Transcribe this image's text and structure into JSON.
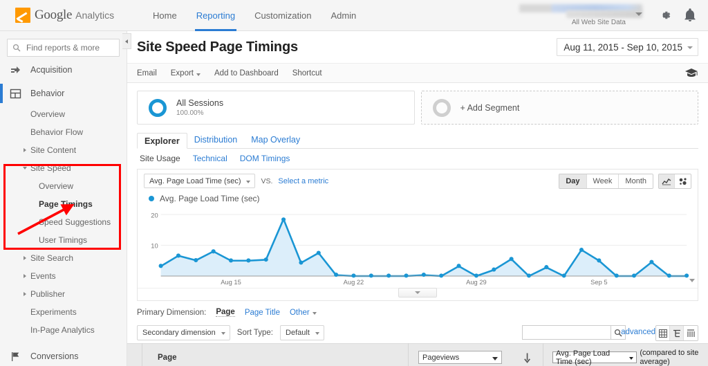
{
  "topbar": {
    "logo_text_1": "Google",
    "logo_text_2": "Analytics",
    "nav": [
      {
        "label": "Home",
        "active": false
      },
      {
        "label": "Reporting",
        "active": true
      },
      {
        "label": "Customization",
        "active": false
      },
      {
        "label": "Admin",
        "active": false
      }
    ],
    "account_view": "All Web Site Data",
    "gear_icon": "gear-icon",
    "bell_icon": "bell-icon"
  },
  "sidebar": {
    "search_placeholder": "Find reports & more",
    "search_value": "",
    "groups": [
      {
        "label": "Acquisition",
        "icon": "acquisition-icon"
      },
      {
        "label": "Behavior",
        "icon": "behavior-icon"
      },
      {
        "label": "Conversions",
        "icon": "conversions-flag-icon"
      }
    ],
    "behavior_items": [
      {
        "label": "Overview",
        "type": "leaf"
      },
      {
        "label": "Behavior Flow",
        "type": "leaf"
      },
      {
        "label": "Site Content",
        "type": "expandable"
      },
      {
        "label": "Site Speed",
        "type": "expanded"
      },
      {
        "label": "Overview",
        "type": "sub"
      },
      {
        "label": "Page Timings",
        "type": "sub-active"
      },
      {
        "label": "Speed Suggestions",
        "type": "sub"
      },
      {
        "label": "User Timings",
        "type": "sub"
      },
      {
        "label": "Site Search",
        "type": "expandable"
      },
      {
        "label": "Events",
        "type": "expandable"
      },
      {
        "label": "Publisher",
        "type": "expandable"
      },
      {
        "label": "Experiments",
        "type": "leaf"
      },
      {
        "label": "In-Page Analytics",
        "type": "leaf"
      }
    ],
    "annotation_color": "#ff0000"
  },
  "main": {
    "page_title": "Site Speed Page Timings",
    "date_range": "Aug 11, 2015 - Sep 10, 2015",
    "actions": [
      {
        "label": "Email",
        "caret": false
      },
      {
        "label": "Export",
        "caret": true
      },
      {
        "label": "Add to Dashboard",
        "caret": false
      },
      {
        "label": "Shortcut",
        "caret": false
      }
    ],
    "help_icon": "graduation-cap-icon",
    "segments": [
      {
        "name": "All Sessions",
        "percent": "100.00%"
      },
      {
        "name": "+ Add Segment"
      }
    ],
    "tabs": [
      {
        "label": "Explorer",
        "active": true
      },
      {
        "label": "Distribution",
        "active": false
      },
      {
        "label": "Map Overlay",
        "active": false
      }
    ],
    "subtabs": [
      {
        "label": "Site Usage",
        "active": true
      },
      {
        "label": "Technical",
        "active": false
      },
      {
        "label": "DOM Timings",
        "active": false
      }
    ],
    "metric_selector": "Avg. Page Load Time (sec)",
    "vs_label": "VS.",
    "select_metric": "Select a metric",
    "granularity": [
      {
        "label": "Day",
        "active": true
      },
      {
        "label": "Week",
        "active": false
      },
      {
        "label": "Month",
        "active": false
      }
    ],
    "chart_type_icons": [
      {
        "name": "line-chart-icon",
        "active": true
      },
      {
        "name": "motion-chart-icon",
        "active": false
      }
    ],
    "legend_label": "Avg. Page Load Time (sec)",
    "primary_dimension_label": "Primary Dimension:",
    "primary_dimension_selected": "Page",
    "primary_dimension_links": [
      {
        "label": "Page Title",
        "caret": false
      },
      {
        "label": "Other",
        "caret": true
      }
    ],
    "secondary_dimension": "Secondary dimension",
    "sort_type_label": "Sort Type:",
    "sort_type_value": "Default",
    "table_search_value": "",
    "advanced_label": "advanced",
    "view_icons": [
      {
        "name": "table-view-icon",
        "active": false
      },
      {
        "name": "pivot-view-icon",
        "active": true
      },
      {
        "name": "comparison-view-icon",
        "active": false
      }
    ],
    "table_headers": {
      "page": "Page",
      "metric_select": "Pageviews",
      "sort_arrow": "down-arrow-icon",
      "compare_metric": "Avg. Page Load Time (sec)",
      "compare_note": "(compared to site average)"
    }
  },
  "chart_data": {
    "type": "area",
    "title": "Avg. Page Load Time (sec)",
    "xlabel": "",
    "ylabel": "",
    "ylim": [
      0,
      20
    ],
    "yticks": [
      10,
      20
    ],
    "grid": true,
    "legend_position": "top-left",
    "line_color": "#1a96d4",
    "fill_color": "#dceefa",
    "x_tick_labels": [
      "Aug 15",
      "Aug 22",
      "Aug 29",
      "Sep 5"
    ],
    "x_tick_indices": [
      4,
      11,
      18,
      25
    ],
    "categories": [
      "Aug 11",
      "Aug 12",
      "Aug 13",
      "Aug 14",
      "Aug 15",
      "Aug 16",
      "Aug 17",
      "Aug 18",
      "Aug 19",
      "Aug 20",
      "Aug 21",
      "Aug 22",
      "Aug 23",
      "Aug 24",
      "Aug 25",
      "Aug 26",
      "Aug 27",
      "Aug 28",
      "Aug 29",
      "Aug 30",
      "Aug 31",
      "Sep 1",
      "Sep 2",
      "Sep 3",
      "Sep 4",
      "Sep 5",
      "Sep 6",
      "Sep 7",
      "Sep 8",
      "Sep 9",
      "Sep 10"
    ],
    "values": [
      3.2,
      6.6,
      5.1,
      8.0,
      5.0,
      5.0,
      5.3,
      18.5,
      4.3,
      7.5,
      0.3,
      0.0,
      0.0,
      0.0,
      0.0,
      0.3,
      0.0,
      3.2,
      0.0,
      2.0,
      5.5,
      0.0,
      2.8,
      0.0,
      8.5,
      5.0,
      0.0,
      0.0,
      4.5,
      0.0,
      0.0
    ],
    "series": [
      {
        "name": "Avg. Page Load Time (sec)",
        "values": [
          3.2,
          6.6,
          5.1,
          8.0,
          5.0,
          5.0,
          5.3,
          18.5,
          4.3,
          7.5,
          0.3,
          0.0,
          0.0,
          0.0,
          0.0,
          0.3,
          0.0,
          3.2,
          0.0,
          2.0,
          5.5,
          0.0,
          2.8,
          0.0,
          8.5,
          5.0,
          0.0,
          0.0,
          4.5,
          0.0,
          0.0
        ]
      }
    ]
  }
}
